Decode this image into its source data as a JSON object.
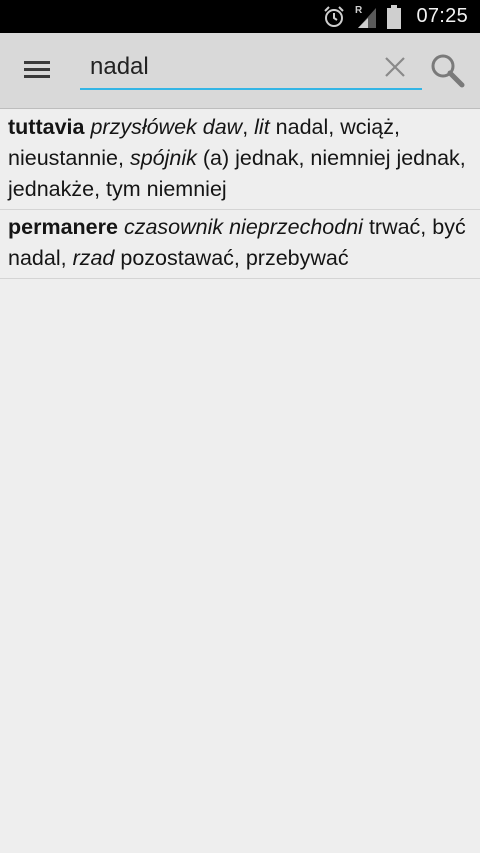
{
  "status_bar": {
    "time": "07:25",
    "icons": [
      "alarm-icon",
      "signal-icon",
      "battery-icon"
    ],
    "roaming_letter": "R"
  },
  "toolbar": {
    "menu_icon": "hamburger-menu-icon",
    "search_value": "nadal",
    "search_underline_color": "#33b5e5",
    "clear_icon": "close-icon",
    "search_icon": "search-icon"
  },
  "results": [
    {
      "headword": "tuttavia",
      "segments": [
        {
          "i": "przysłówek daw"
        },
        {
          "t": ", "
        },
        {
          "i": "lit"
        },
        {
          "t": " nadal, wciąż, nieustannie, "
        },
        {
          "i": "spójnik"
        },
        {
          "t": " (a) jednak, niemniej jednak, jednakże, tym niemniej"
        }
      ]
    },
    {
      "headword": "permanere",
      "segments": [
        {
          "i": "czasownik nieprzechodni"
        },
        {
          "t": " trwać, być nadal, "
        },
        {
          "i": "rzad"
        },
        {
          "t": " pozostawać, przebywać"
        }
      ]
    }
  ]
}
